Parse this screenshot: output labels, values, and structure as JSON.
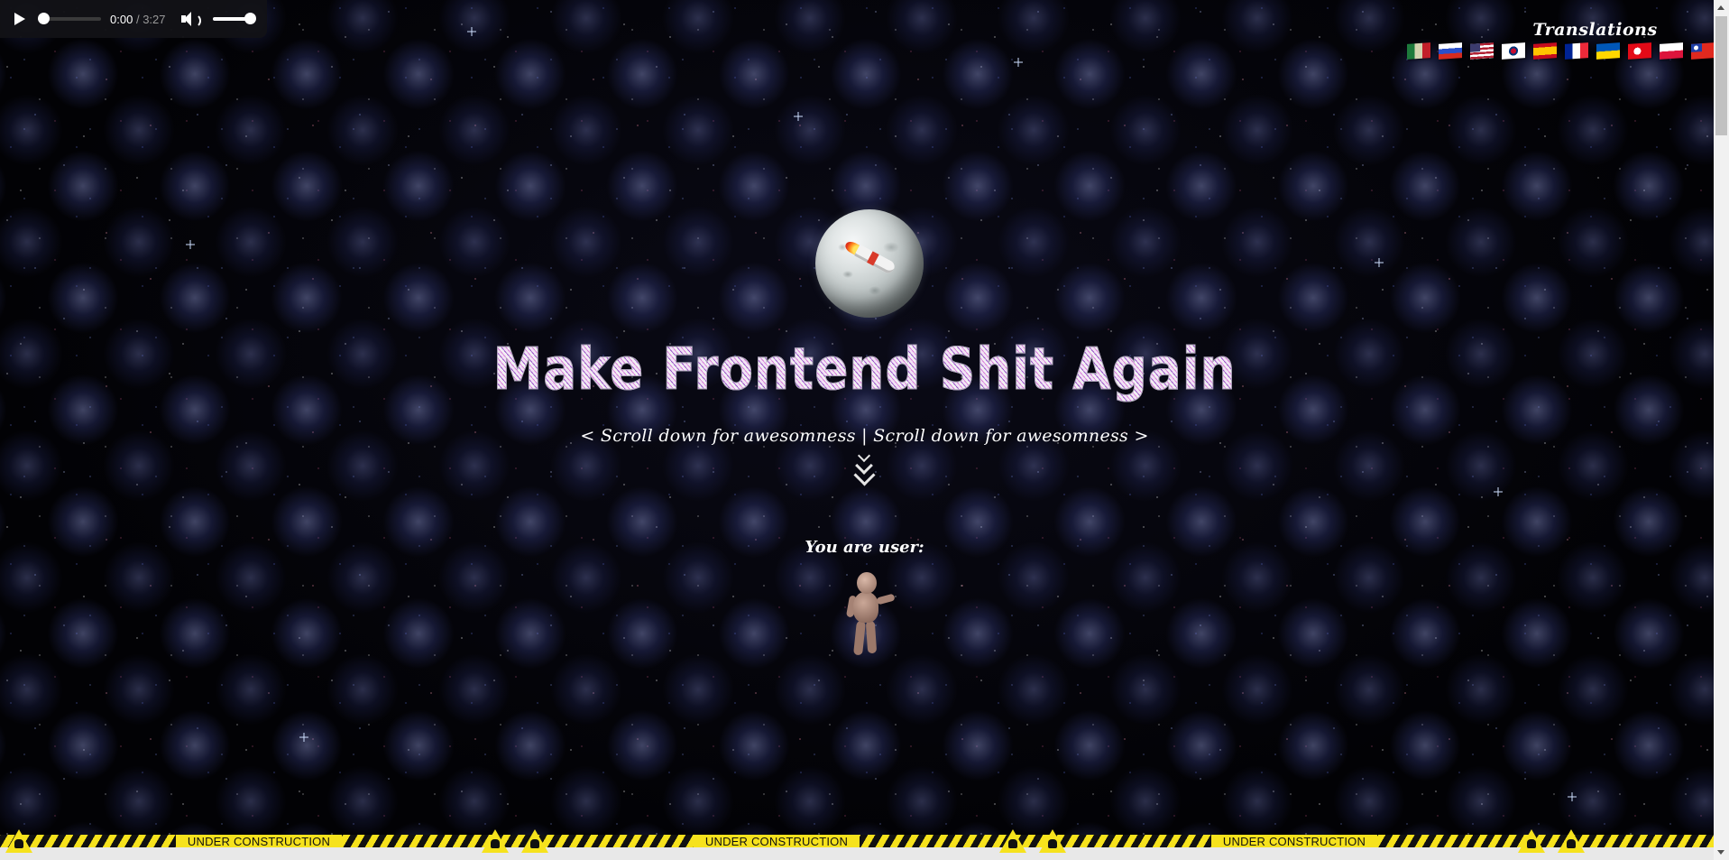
{
  "audio_player": {
    "current_time": "0:00",
    "separator": "/",
    "duration": "3:27",
    "progress": 0,
    "volume": 1.0
  },
  "translations": {
    "title": "Translations",
    "flags": [
      {
        "icon": "flag-icon-1"
      },
      {
        "icon": "flag-icon-russia"
      },
      {
        "icon": "flag-icon-usa"
      },
      {
        "icon": "flag-icon-korea"
      },
      {
        "icon": "flag-icon-spain"
      },
      {
        "icon": "flag-icon-france"
      },
      {
        "icon": "flag-icon-ukraine"
      },
      {
        "icon": "flag-icon-turkey"
      },
      {
        "icon": "flag-icon-poland"
      },
      {
        "icon": "flag-icon-taiwan"
      }
    ]
  },
  "hero": {
    "planet_icon": "planet-with-rocket-icon",
    "title": "Make Frontend Shit Again",
    "scroll_hint": "< Scroll down for awesomness | Scroll down for awesomness >",
    "scroll_icon": "triple-chevron-down-icon"
  },
  "user": {
    "label": "You are user:",
    "avatar_icon": "dancing-baby-icon"
  },
  "footer": {
    "construction_labels": [
      "UNDER CONSTRUCTION",
      "UNDER CONSTRUCTION",
      "UNDER CONSTRUCTION"
    ],
    "colors": {
      "stripe_yellow": "#f6e21d",
      "stripe_black": "#111111"
    }
  }
}
